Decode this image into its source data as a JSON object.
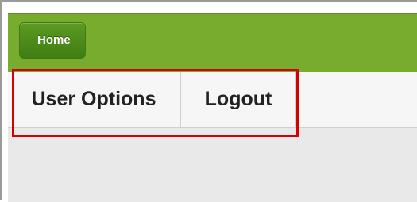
{
  "header": {
    "home_label": "Home",
    "bar_color": "#77ac2f",
    "button_color": "#4a8a1b"
  },
  "tabs": [
    {
      "label": "User Options"
    },
    {
      "label": "Logout"
    }
  ],
  "annotation": {
    "highlight_color": "#d60000"
  }
}
